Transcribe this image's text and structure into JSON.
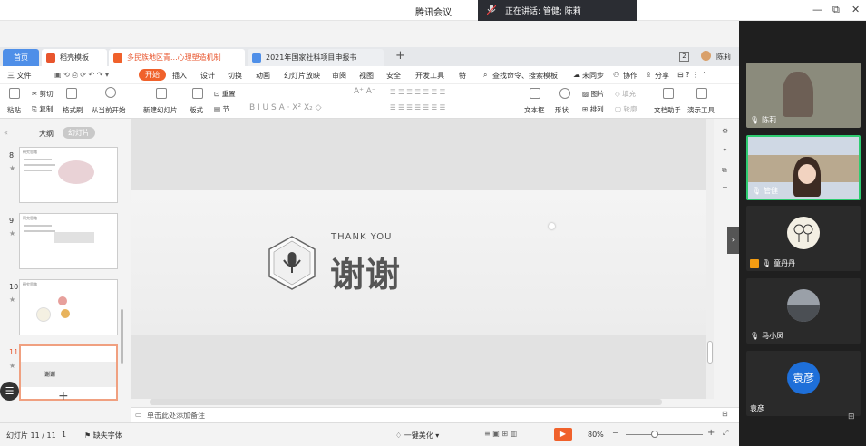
{
  "meeting": {
    "app_title": "腾讯会议",
    "speaking": "正在讲话: 管健; 陈莉"
  },
  "tabs": [
    {
      "label": "首页"
    },
    {
      "label": "稻壳模板"
    },
    {
      "label": "多民族地区青...心理塑造机制"
    },
    {
      "label": "2021年国家社科项目申报书"
    }
  ],
  "tab_badge": "2",
  "user_name": "陈莉",
  "menu": {
    "file": "三 文件",
    "items": [
      "开始",
      "插入",
      "设计",
      "切换",
      "动画",
      "幻灯片放映",
      "审阅",
      "视图",
      "安全",
      "开发工具",
      "特"
    ],
    "search": "查找命令、搜索模板",
    "sync": "未同步",
    "collab": "协作",
    "share": "分享"
  },
  "ribbon": {
    "paste": "粘贴",
    "cut": "剪切",
    "copy": "复制",
    "format_painter": "格式刷",
    "from_current": "从当前开始",
    "new_slide": "新建幻灯片",
    "layout": "版式",
    "section": "节",
    "reset": "重置",
    "textbox": "文本框",
    "shape": "形状",
    "picture": "图片",
    "arrange": "排列",
    "fill": "填充",
    "outline": "轮廓",
    "doc_assistant": "文档助手",
    "present_tools": "演示工具"
  },
  "panel": {
    "outline_tab": "大纲",
    "slides_tab": "幻灯片",
    "slides": [
      {
        "num": "8",
        "title": "研究思路"
      },
      {
        "num": "9",
        "title": "研究思路"
      },
      {
        "num": "10",
        "title": "研究思路"
      },
      {
        "num": "11",
        "title": "谢谢"
      }
    ]
  },
  "slide": {
    "thank_you": "THANK YOU",
    "title": "谢谢"
  },
  "notes_placeholder": "单击此处添加备注",
  "status": {
    "slide_count": "幻灯片 11 / 11",
    "page": "1",
    "font_missing": "缺失字体",
    "beautify": "一键美化",
    "zoom": "80%"
  },
  "participants": [
    {
      "name": "陈莉"
    },
    {
      "name": "管健"
    },
    {
      "name": "童丹丹"
    },
    {
      "name": "马小凤"
    },
    {
      "name": "袁彦",
      "avatar_text": "袁彦",
      "sub": "袁彦"
    }
  ],
  "colors": {
    "accent_orange": "#e8552d",
    "home_tab_blue": "#4f8fe8",
    "active_red": "#f0612b",
    "meeting_dark": "#1f1f1f"
  }
}
